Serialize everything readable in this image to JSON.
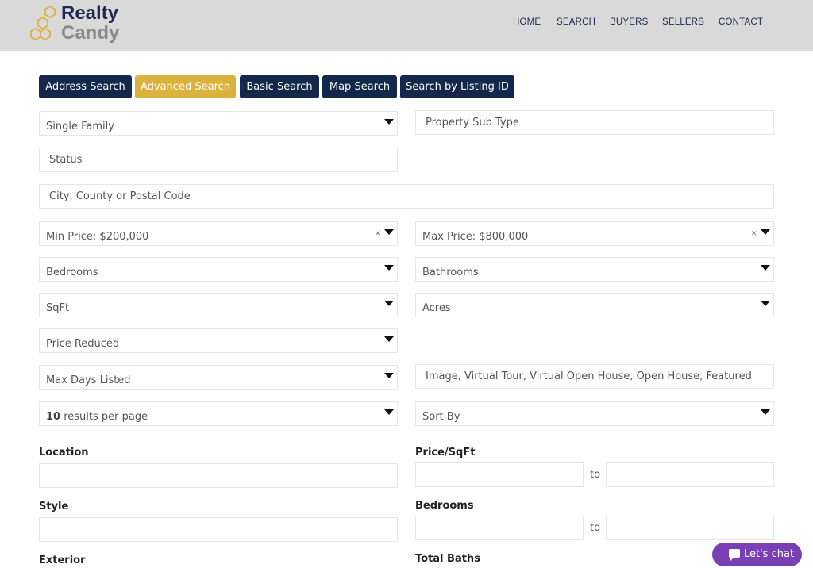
{
  "header": {
    "logo": {
      "line1": "Realty",
      "line2": "Candy"
    },
    "nav": [
      "HOME",
      "SEARCH",
      "BUYERS",
      "SELLERS",
      "CONTACT"
    ]
  },
  "tabs": [
    {
      "label": "Address Search",
      "active": false
    },
    {
      "label": "Advanced Search",
      "active": true
    },
    {
      "label": "Basic Search",
      "active": false
    },
    {
      "label": "Map Search",
      "active": false
    },
    {
      "label": "Search by Listing ID",
      "active": false
    }
  ],
  "form": {
    "property_type": "Single Family",
    "property_sub_type_placeholder": "Property Sub Type",
    "status_placeholder": "Status",
    "location_placeholder": "City, County or Postal Code",
    "min_price": "Min Price: $200,000",
    "max_price": "Max Price: $800,000",
    "bedrooms": "Bedrooms",
    "bathrooms": "Bathrooms",
    "sqft": "SqFt",
    "acres": "Acres",
    "price_reduced": "Price Reduced",
    "max_days_listed": "Max Days Listed",
    "features_placeholder": "Image, Virtual Tour, Virtual Open House, Open House, Featured",
    "results_count": "10",
    "results_suffix": " results per page",
    "sort_by": "Sort By",
    "clear_symbol": "×"
  },
  "extra": {
    "location_label": "Location",
    "price_sqft_label": "Price/SqFt",
    "style_label": "Style",
    "bedrooms_label": "Bedrooms",
    "exterior_label": "Exterior",
    "total_baths_label": "Total Baths",
    "to": "to"
  },
  "chat": {
    "label": "Let's chat"
  },
  "colors": {
    "navy": "#13284a",
    "gold": "#dcb23f",
    "purple": "#7b3fb5",
    "header_bg": "#d9d9d9"
  },
  "icons": [
    "hexagon-logo-icon",
    "dropdown-caret-icon",
    "clear-icon",
    "chat-bubble-icon"
  ]
}
